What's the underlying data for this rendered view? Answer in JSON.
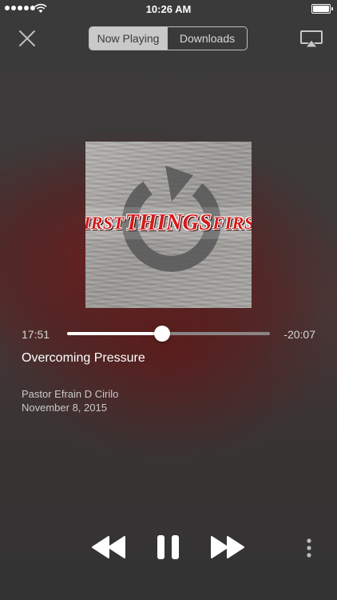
{
  "status_bar": {
    "time": "10:26 AM",
    "signal_bars": 5,
    "battery_level": 1.0
  },
  "header": {
    "tabs": [
      {
        "label": "Now Playing",
        "selected": true
      },
      {
        "label": "Downloads",
        "selected": false
      }
    ],
    "close_icon": "close-icon",
    "airplay_icon": "airplay-icon"
  },
  "artwork": {
    "title_words": [
      "FIRST",
      "THINGS",
      "FIRST"
    ],
    "accent_color": "#d31b1b"
  },
  "player": {
    "elapsed": "17:51",
    "remaining": "-20:07",
    "progress": 0.47
  },
  "track": {
    "title": "Overcoming Pressure",
    "artist": "Pastor Efrain D Cirilo",
    "date": "November 8, 2015"
  },
  "controls": {
    "rewind_icon": "rewind-icon",
    "pause_icon": "pause-icon",
    "fast_forward_icon": "fast-forward-icon",
    "more_icon": "more-vertical-icon"
  }
}
